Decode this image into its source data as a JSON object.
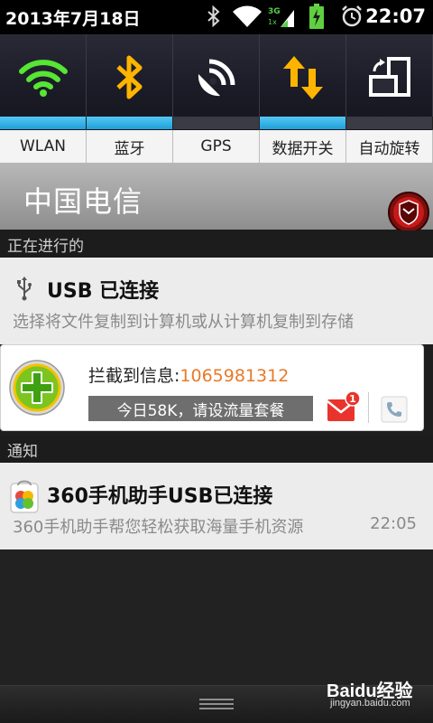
{
  "status_bar": {
    "date": "2013年7月18日",
    "time": "22:07",
    "icons": [
      "bluetooth-icon",
      "wifi-signal-icon",
      "cellular-3g-icon",
      "battery-charging-icon",
      "alarm-clock-icon"
    ]
  },
  "quick_settings": {
    "tiles": [
      {
        "label": "WLAN",
        "icon": "wifi-icon",
        "active": true
      },
      {
        "label": "蓝牙",
        "icon": "bluetooth-icon",
        "active": true
      },
      {
        "label": "GPS",
        "icon": "gps-satellite-icon",
        "active": false
      },
      {
        "label": "数据开关",
        "icon": "data-transfer-icon",
        "active": true
      },
      {
        "label": "自动旋转",
        "icon": "auto-rotate-icon",
        "active": false
      }
    ],
    "accent": "#2aa9e6"
  },
  "carrier": {
    "name": "中国电信"
  },
  "sections": {
    "ongoing": "正在进行的",
    "notifications": "通知"
  },
  "usb_notification": {
    "title": "USB 已连接",
    "description": "选择将文件复制到计算机或从计算机复制到存储"
  },
  "sms_interception_card": {
    "prefix": "拦截到信息:",
    "number": "1065981312",
    "traffic": "今日58K，请设流量套餐",
    "badge_count": "1"
  },
  "assistant_notification": {
    "title": "360手机助手USB已连接",
    "description": "360手机助手帮您轻松获取海量手机资源",
    "time": "22:05"
  },
  "watermark": {
    "brand": "Baidu经验",
    "url": "jingyan.baidu.com"
  }
}
